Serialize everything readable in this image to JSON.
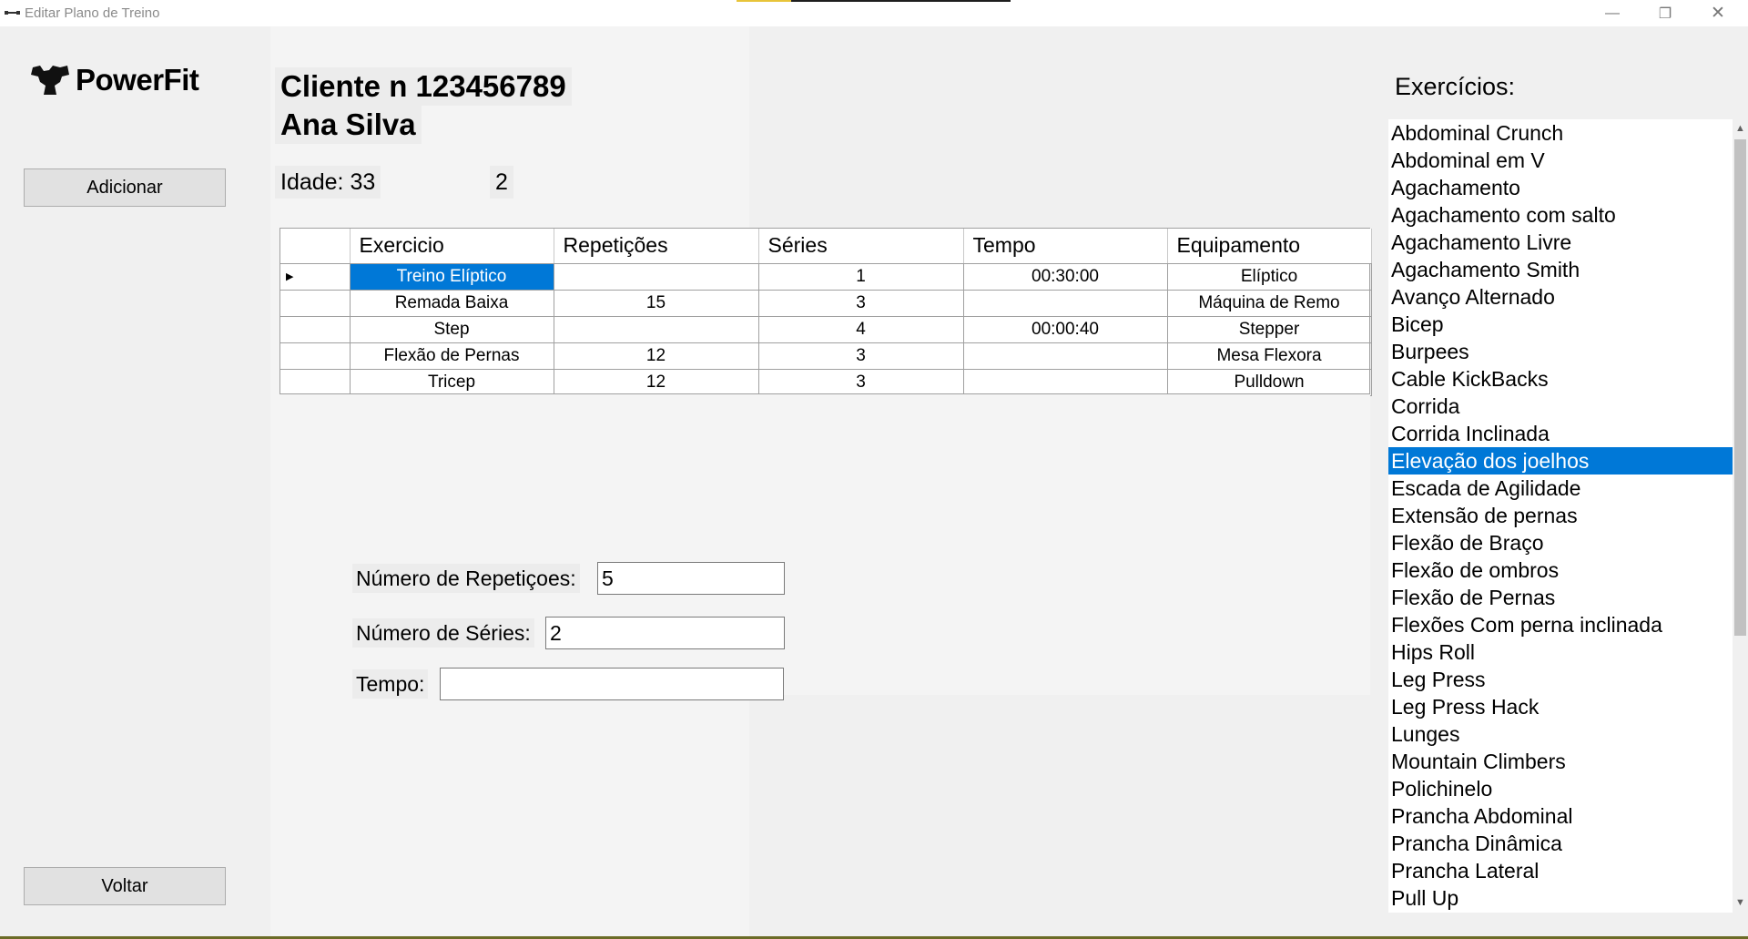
{
  "window": {
    "title": "Editar Plano de Treino",
    "controls": {
      "minimize": "—",
      "maximize": "❐",
      "close": "✕"
    }
  },
  "logo": {
    "text": "PowerFit"
  },
  "buttons": {
    "add": "Adicionar",
    "back": "Voltar"
  },
  "client": {
    "number_line": "Cliente n 123456789",
    "name": "Ana Silva",
    "age_label": "Idade: 33",
    "extra_value": "2"
  },
  "grid": {
    "columns": [
      "Exercicio",
      "Repetições",
      "Séries",
      "Tempo",
      "Equipamento"
    ],
    "current_row_marker": "▶",
    "rows": [
      {
        "exercicio": "Treino Elíptico",
        "repeticoes": "",
        "series": "1",
        "tempo": "00:30:00",
        "equipamento": "Elíptico"
      },
      {
        "exercicio": "Remada Baixa",
        "repeticoes": "15",
        "series": "3",
        "tempo": "",
        "equipamento": "Máquina de Remo"
      },
      {
        "exercicio": "Step",
        "repeticoes": "",
        "series": "4",
        "tempo": "00:00:40",
        "equipamento": "Stepper"
      },
      {
        "exercicio": "Flexão de Pernas",
        "repeticoes": "12",
        "series": "3",
        "tempo": "",
        "equipamento": "Mesa Flexora"
      },
      {
        "exercicio": "Tricep",
        "repeticoes": "12",
        "series": "3",
        "tempo": "",
        "equipamento": "Pulldown"
      }
    ]
  },
  "form": {
    "reps_label": "Número de Repetiçoes:",
    "reps_value": "5",
    "series_label": "Número de Séries:",
    "series_value": "2",
    "time_label": "Tempo:",
    "time_value": ""
  },
  "exercises": {
    "title": "Exercícios:",
    "selected_index": 12,
    "items": [
      "Abdominal Crunch",
      "Abdominal em V",
      "Agachamento",
      "Agachamento com salto",
      "Agachamento Livre",
      "Agachamento Smith",
      "Avanço Alternado",
      "Bicep",
      "Burpees",
      "Cable KickBacks",
      "Corrida",
      "Corrida Inclinada",
      "Elevação dos joelhos",
      "Escada de Agilidade",
      "Extensão de pernas",
      "Flexão de Braço",
      "Flexão de ombros",
      "Flexão de Pernas",
      "Flexões Com perna inclinada",
      "Hips Roll",
      "Leg Press",
      "Leg Press Hack",
      "Lunges",
      "Mountain Climbers",
      "Polichinelo",
      "Prancha Abdominal",
      "Prancha Dinâmica",
      "Prancha Lateral",
      "Pull Up"
    ]
  },
  "colors": {
    "selection": "#0078d7",
    "accent_strip_yellow": "#e8c43a",
    "accent_strip_dark": "#1e1e1e"
  }
}
